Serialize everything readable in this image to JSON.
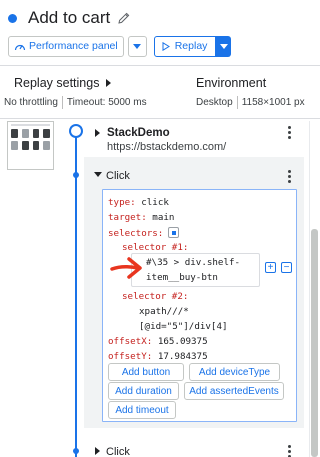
{
  "header": {
    "title": "Add to cart",
    "perf_label": "Performance panel",
    "replay_label": "Replay"
  },
  "settings": {
    "replay_title": "Replay settings",
    "throttling": "No throttling",
    "timeout": "Timeout: 5000 ms",
    "env_title": "Environment",
    "device": "Desktop",
    "resolution": "1158×1001 px"
  },
  "steps": [
    {
      "title": "StackDemo",
      "url": "https://bstackdemo.com/"
    },
    {
      "title": "Click",
      "props": {
        "type_key": "type:",
        "type_val": "click",
        "target_key": "target:",
        "target_val": "main",
        "selectors_key": "selectors:",
        "sel1_key": "selector #1:",
        "sel1_line1": "#\\35 > div.shelf-",
        "sel1_line2": "item__buy-btn",
        "sel2_key": "selector #2:",
        "sel2_line1": "xpath///*",
        "sel2_line2": "[@id=\"5\"]/div[4]",
        "offsetX_key": "offsetX:",
        "offsetX_val": "165.09375",
        "offsetY_key": "offsetY:",
        "offsetY_val": "17.984375"
      },
      "buttons": {
        "add_button": "Add button",
        "add_device": "Add deviceType",
        "add_duration": "Add duration",
        "add_asserted": "Add assertedEvents",
        "add_timeout": "Add timeout"
      }
    },
    {
      "title": "Click"
    }
  ],
  "icons": {
    "edit": "pencil-icon",
    "performance": "gauge-icon",
    "replay": "play-icon",
    "selector_picker": "selector-picker-icon",
    "annotation": "red-arrow"
  },
  "colors": {
    "accent": "#1a73e8",
    "key": "#c5221f",
    "arrow": "#e8351f"
  }
}
